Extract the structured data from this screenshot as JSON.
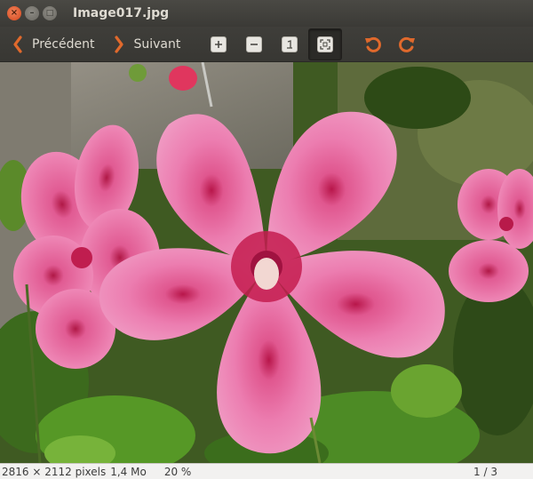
{
  "window": {
    "title": "Image017.jpg",
    "close_glyph": "×",
    "min_glyph": "–",
    "max_glyph": "□"
  },
  "toolbar": {
    "previous_label": "Précédent",
    "next_label": "Suivant",
    "zoom_in_icon": "zoom-in-icon",
    "zoom_out_icon": "zoom-out-icon",
    "zoom_normal_icon": "zoom-normal-icon",
    "zoom_fit_icon": "zoom-fit-icon",
    "rotate_left_icon": "rotate-left-icon",
    "rotate_right_icon": "rotate-right-icon",
    "accent_color": "#e0692c"
  },
  "image": {
    "subject": "pink hibiscus flowers"
  },
  "status": {
    "dimensions": "2816 × 2112 pixels",
    "file_size": "1,4 Mo",
    "zoom": "20 %",
    "page": "1 / 3"
  }
}
